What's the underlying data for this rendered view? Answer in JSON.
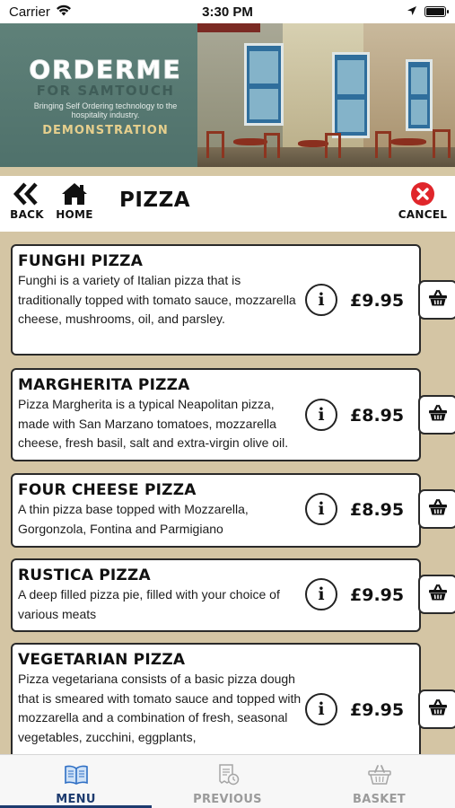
{
  "status_bar": {
    "carrier": "Carrier",
    "time": "3:30 PM",
    "battery_level": 1.0
  },
  "banner": {
    "brand_title": "ORDERME",
    "brand_subtitle": "FOR SAMTOUCH",
    "tagline": "Bringing Self Ordering technology to the hospitality industry.",
    "mode": "DEMONSTRATION"
  },
  "nav": {
    "back_label": "BACK",
    "home_label": "HOME",
    "title": "PIZZA",
    "cancel_label": "CANCEL"
  },
  "menu_items": [
    {
      "name": "FUNGHI PIZZA",
      "description": "Funghi is a variety of Italian pizza that is traditionally topped with tomato sauce, mozzarella cheese, mushrooms, oil, and parsley.",
      "price": "£9.95"
    },
    {
      "name": "MARGHERITA PIZZA",
      "description": "Pizza Margherita is a typical Neapolitan pizza, made with San Marzano tomatoes, mozzarella cheese, fresh basil, salt and extra-virgin olive oil.",
      "price": "£8.95"
    },
    {
      "name": "FOUR CHEESE PIZZA",
      "description": "A thin pizza base topped with Mozzarella, Gorgonzola, Fontina and Parmigiano",
      "price": "£8.95"
    },
    {
      "name": "RUSTICA PIZZA",
      "description": "A deep filled pizza pie, filled with your choice of various meats",
      "price": "£9.95"
    },
    {
      "name": "VEGETARIAN PIZZA",
      "description": "Pizza vegetariana consists of a basic pizza dough that is smeared with tomato sauce and topped with mozzarella and a combination of fresh, seasonal vegetables, zucchini, eggplants,",
      "price": "£9.95"
    }
  ],
  "item_info_symbol": "i",
  "tabs": [
    {
      "label": "MENU",
      "icon": "book-icon",
      "active": true
    },
    {
      "label": "PREVIOUS",
      "icon": "receipt-clock-icon",
      "active": false
    },
    {
      "label": "BASKET",
      "icon": "basket-icon",
      "active": false
    }
  ],
  "colors": {
    "background": "#d4c5a4",
    "accent": "#1d3b6f",
    "cancel": "#e0262b",
    "banner": "#5b7d76",
    "demo_text": "#e6cf8d"
  }
}
